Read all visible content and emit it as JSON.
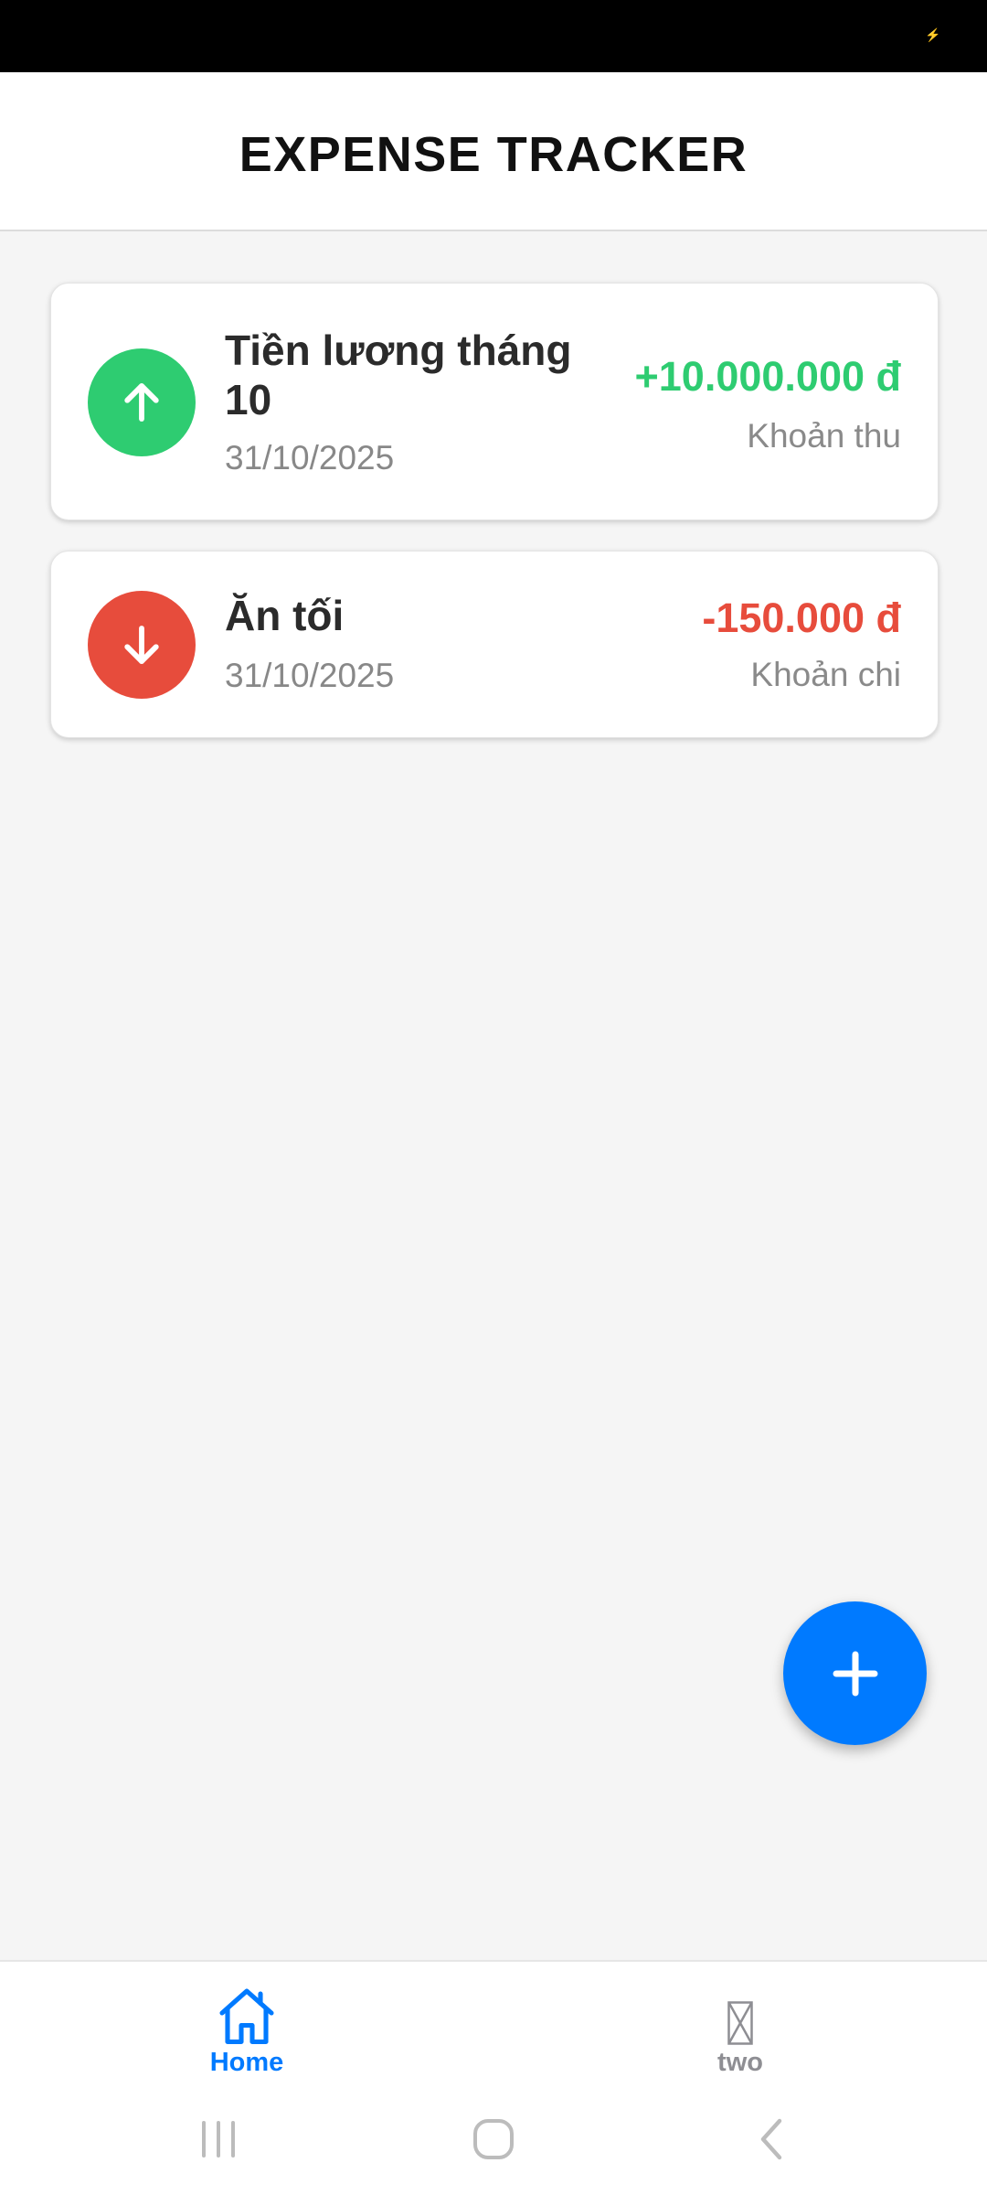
{
  "colors": {
    "income": "#2ecc71",
    "expense": "#e74c3c",
    "accent": "#007aff",
    "tab_inactive": "#8e8e93"
  },
  "header": {
    "title": "EXPENSE TRACKER"
  },
  "transactions": [
    {
      "name": "Tiền lương tháng 10",
      "date": "31/10/2025",
      "amount": "+10.000.000 đ",
      "type": "Khoản thu",
      "icon": "arrow-up-icon"
    },
    {
      "name": "Ăn tối",
      "date": "31/10/2025",
      "amount": "-150.000 đ",
      "type": "Khoản chi",
      "icon": "arrow-down-icon"
    }
  ],
  "fab": {
    "icon": "plus-icon"
  },
  "tabs": [
    {
      "label": "Home",
      "icon": "home-icon",
      "active": true
    },
    {
      "label": "two",
      "icon": "missing-icon",
      "active": false
    }
  ],
  "system_nav": {
    "recents_icon": "recents-icon",
    "home_icon": "home-circle-icon",
    "back_icon": "back-icon"
  }
}
